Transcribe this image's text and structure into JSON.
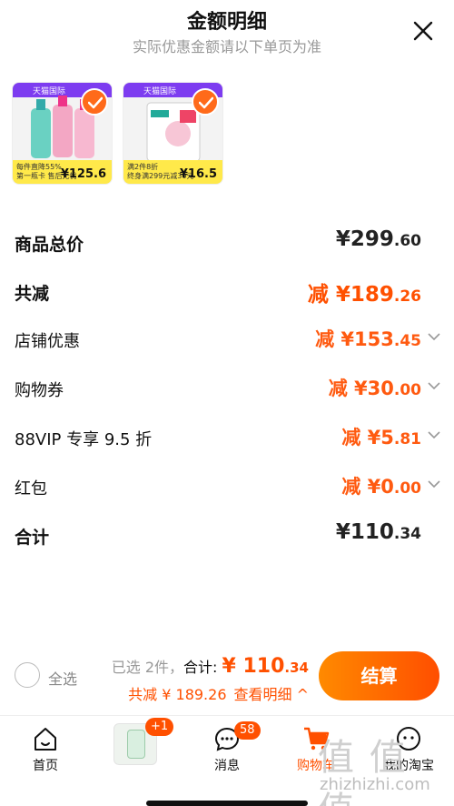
{
  "header": {
    "title": "金额明细",
    "subtitle": "实际优惠金额请以下单页为准"
  },
  "products": [
    {
      "store_tag": "天猫国际",
      "promo_lines": [
        "每件直降55%",
        "第一瓶卡  售后无忧"
      ],
      "price": "125.6",
      "selected": true
    },
    {
      "store_tag": "天猫国际",
      "promo_lines": [
        "满2件8折",
        "终身满299元减30元"
      ],
      "price": "16.5",
      "selected": true
    }
  ],
  "breakdown": {
    "goods_total": {
      "label": "商品总价",
      "amount_int": "¥299",
      "amount_dec": ".60"
    },
    "total_reduction": {
      "label": "共减",
      "amount_int": "减 ¥189",
      "amount_dec": ".26"
    },
    "store_discount": {
      "label": "店铺优惠",
      "amount_int": "减 ¥153",
      "amount_dec": ".45"
    },
    "coupon": {
      "label": "购物券",
      "amount_int": "减 ¥30",
      "amount_dec": ".00"
    },
    "vip": {
      "label": "88VIP 专享 9.5 折",
      "amount_int": "减 ¥5",
      "amount_dec": ".81"
    },
    "red_packet": {
      "label": "红包",
      "amount_int": "减 ¥0",
      "amount_dec": ".00"
    },
    "sum": {
      "label": "合计",
      "amount_int": "¥110",
      "amount_dec": ".34"
    }
  },
  "bottom_bar": {
    "select_all": "全选",
    "selected_count": "已选 2件，",
    "total_label": "合计: ",
    "total_int": "¥ 110",
    "total_dec": ".34",
    "reduction": "共减 ¥ 189.26",
    "view_detail": "查看明细 ^",
    "checkout": "结算"
  },
  "tabbar": {
    "home": "首页",
    "promo_badge": "+1",
    "messages": "消息",
    "messages_badge": "58",
    "cart": "购物车",
    "mine": "我的淘宝"
  },
  "watermark": {
    "glyphs": "值 值 值",
    "url": "zhizhizhi.com"
  },
  "colors": {
    "accent": "#ff5000",
    "checkout_start": "#ff8a00",
    "checkout_end": "#ff4e00"
  }
}
